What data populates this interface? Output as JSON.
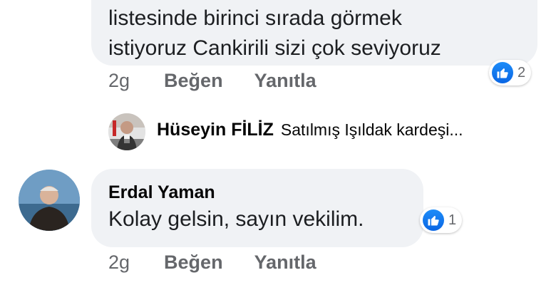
{
  "comments": [
    {
      "text": "listesinde birinci sırada görmek\nistiyoruz Cankirili sizi çok seviyoruz",
      "time": "2g",
      "like_label": "Beğen",
      "reply_label": "Yanıtla",
      "reaction_count": "2"
    },
    {
      "author": "Erdal Yaman",
      "text": "Kolay gelsin, sayın vekilim.",
      "time": "2g",
      "like_label": "Beğen",
      "reply_label": "Yanıtla",
      "reaction_count": "1"
    }
  ],
  "reply_preview": {
    "author": "Hüseyin FİLİZ",
    "snippet": "Satılmış Işıldak kardeşi..."
  },
  "colors": {
    "bubble": "#f0f2f5",
    "meta_text": "#65676b",
    "like_blue": "#1877f2"
  },
  "icons": {
    "reaction": "thumbs-up-icon"
  }
}
